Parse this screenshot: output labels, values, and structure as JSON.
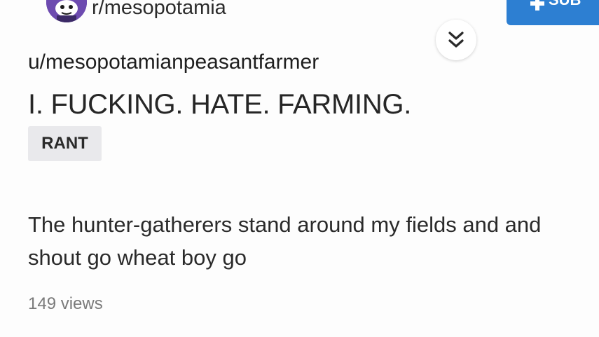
{
  "header": {
    "subreddit": "r/mesopotamia",
    "subscribe_label": "SUB",
    "avatar_icon": "snoo-avatar-icon",
    "collapse_icon": "chevron-double-down-icon"
  },
  "post": {
    "author": "u/mesopotamianpeasantfarmer",
    "title": "I. FUCKING. HATE. FARMING.",
    "flair": "RANT",
    "body": "The hunter-gatherers stand around my fields and and shout go wheat boy go",
    "views": "149 views"
  },
  "colors": {
    "subscribe_button": "#2d7fd2",
    "avatar_bg": "#6d4bb0",
    "flair_bg": "#e9e9ec",
    "muted_text": "#7a7a7a"
  }
}
